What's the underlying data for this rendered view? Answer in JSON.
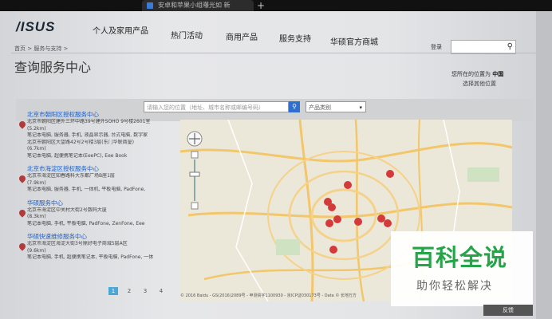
{
  "browser": {
    "tab_title": "安卓和苹果小组曝光如 新",
    "new_tab_symbol": "+"
  },
  "header": {
    "logo": "/ISUS",
    "nav": [
      "个人及家用产品",
      "热门活动",
      "商用产品",
      "服务支持",
      "华硕官方商城"
    ],
    "login": "登录",
    "search_icon": "search-icon"
  },
  "breadcrumb": "首页 > 服务与支持 >",
  "page_title": "查询服务中心",
  "location": {
    "label": "您所在的位置为",
    "value": "中国",
    "change": "选择其他位置"
  },
  "filters": {
    "search_placeholder": "请输入您的位置（地址、城市名称或邮编号码）",
    "product_select": "产品类别"
  },
  "centers": [
    {
      "name": "北京市朝阳区授权服务中心",
      "lines": [
        "北京市朝阳区建外三环中路39号建外SOHO 9号楼2601室",
        "(5.2km)",
        "笔记本电脑, 服务器, 手机, 液晶显示器, 台式电脑, 数字家",
        "北京市朝阳区大望路42号2号楼3层(东门华联商厦)",
        "(6.7km)",
        "笔记本电脑, 超便携笔记本(EeePC), Eee Book"
      ]
    },
    {
      "name": "北京市海淀区授权服务中心",
      "lines": [
        "北京市海淀区知春路科大东都广场B座1层",
        "(7.9km)",
        "笔记本电脑, 服务器, 手机, 一体机, 平板电脑, PadFone,"
      ]
    },
    {
      "name": "华硕服务中心",
      "lines": [
        "北京市海淀区中关村大街2号数码大厦",
        "(8.3km)",
        "笔记本电脑, 手机, 平板电脑, PadFone, ZenFone, Eee"
      ]
    },
    {
      "name": "华硕快速维修服务中心",
      "lines": [
        "北京市海淀区海淀大街3号鼎好电子商城5层A区",
        "(9.6km)",
        "笔记本电脑, 手机, 超便携笔记本, 平板电脑, PadFone, 一体"
      ]
    }
  ],
  "pager": [
    "1",
    "2",
    "3",
    "4"
  ],
  "map": {
    "copyright": "© 2016 Baidu - GS(2016)2089号 - 甲测资字1100930 - 京ICP证030173号 - Data © 长地万方",
    "pins": 10
  },
  "watermark": {
    "title": "百科全说",
    "subtitle": "助你轻松解决"
  },
  "feedback": "反馈"
}
